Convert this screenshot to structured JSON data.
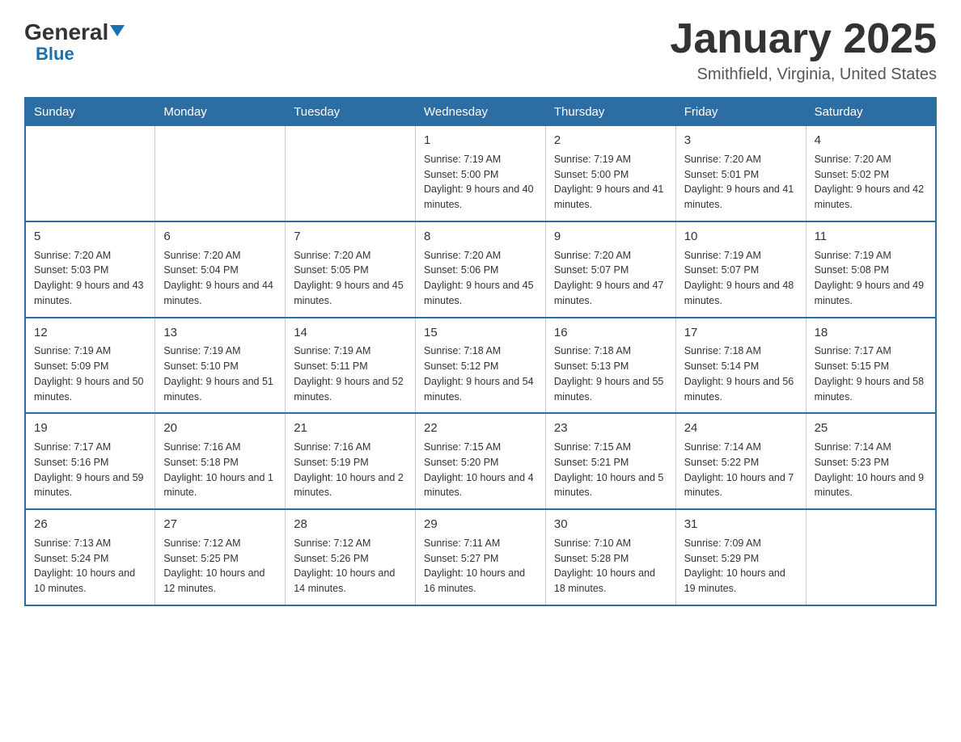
{
  "header": {
    "logo_general": "General",
    "logo_blue": "Blue",
    "month_title": "January 2025",
    "location": "Smithfield, Virginia, United States"
  },
  "days_of_week": [
    "Sunday",
    "Monday",
    "Tuesday",
    "Wednesday",
    "Thursday",
    "Friday",
    "Saturday"
  ],
  "weeks": [
    [
      {
        "day": "",
        "info": ""
      },
      {
        "day": "",
        "info": ""
      },
      {
        "day": "",
        "info": ""
      },
      {
        "day": "1",
        "info": "Sunrise: 7:19 AM\nSunset: 5:00 PM\nDaylight: 9 hours\nand 40 minutes."
      },
      {
        "day": "2",
        "info": "Sunrise: 7:19 AM\nSunset: 5:00 PM\nDaylight: 9 hours\nand 41 minutes."
      },
      {
        "day": "3",
        "info": "Sunrise: 7:20 AM\nSunset: 5:01 PM\nDaylight: 9 hours\nand 41 minutes."
      },
      {
        "day": "4",
        "info": "Sunrise: 7:20 AM\nSunset: 5:02 PM\nDaylight: 9 hours\nand 42 minutes."
      }
    ],
    [
      {
        "day": "5",
        "info": "Sunrise: 7:20 AM\nSunset: 5:03 PM\nDaylight: 9 hours\nand 43 minutes."
      },
      {
        "day": "6",
        "info": "Sunrise: 7:20 AM\nSunset: 5:04 PM\nDaylight: 9 hours\nand 44 minutes."
      },
      {
        "day": "7",
        "info": "Sunrise: 7:20 AM\nSunset: 5:05 PM\nDaylight: 9 hours\nand 45 minutes."
      },
      {
        "day": "8",
        "info": "Sunrise: 7:20 AM\nSunset: 5:06 PM\nDaylight: 9 hours\nand 45 minutes."
      },
      {
        "day": "9",
        "info": "Sunrise: 7:20 AM\nSunset: 5:07 PM\nDaylight: 9 hours\nand 47 minutes."
      },
      {
        "day": "10",
        "info": "Sunrise: 7:19 AM\nSunset: 5:07 PM\nDaylight: 9 hours\nand 48 minutes."
      },
      {
        "day": "11",
        "info": "Sunrise: 7:19 AM\nSunset: 5:08 PM\nDaylight: 9 hours\nand 49 minutes."
      }
    ],
    [
      {
        "day": "12",
        "info": "Sunrise: 7:19 AM\nSunset: 5:09 PM\nDaylight: 9 hours\nand 50 minutes."
      },
      {
        "day": "13",
        "info": "Sunrise: 7:19 AM\nSunset: 5:10 PM\nDaylight: 9 hours\nand 51 minutes."
      },
      {
        "day": "14",
        "info": "Sunrise: 7:19 AM\nSunset: 5:11 PM\nDaylight: 9 hours\nand 52 minutes."
      },
      {
        "day": "15",
        "info": "Sunrise: 7:18 AM\nSunset: 5:12 PM\nDaylight: 9 hours\nand 54 minutes."
      },
      {
        "day": "16",
        "info": "Sunrise: 7:18 AM\nSunset: 5:13 PM\nDaylight: 9 hours\nand 55 minutes."
      },
      {
        "day": "17",
        "info": "Sunrise: 7:18 AM\nSunset: 5:14 PM\nDaylight: 9 hours\nand 56 minutes."
      },
      {
        "day": "18",
        "info": "Sunrise: 7:17 AM\nSunset: 5:15 PM\nDaylight: 9 hours\nand 58 minutes."
      }
    ],
    [
      {
        "day": "19",
        "info": "Sunrise: 7:17 AM\nSunset: 5:16 PM\nDaylight: 9 hours\nand 59 minutes."
      },
      {
        "day": "20",
        "info": "Sunrise: 7:16 AM\nSunset: 5:18 PM\nDaylight: 10 hours\nand 1 minute."
      },
      {
        "day": "21",
        "info": "Sunrise: 7:16 AM\nSunset: 5:19 PM\nDaylight: 10 hours\nand 2 minutes."
      },
      {
        "day": "22",
        "info": "Sunrise: 7:15 AM\nSunset: 5:20 PM\nDaylight: 10 hours\nand 4 minutes."
      },
      {
        "day": "23",
        "info": "Sunrise: 7:15 AM\nSunset: 5:21 PM\nDaylight: 10 hours\nand 5 minutes."
      },
      {
        "day": "24",
        "info": "Sunrise: 7:14 AM\nSunset: 5:22 PM\nDaylight: 10 hours\nand 7 minutes."
      },
      {
        "day": "25",
        "info": "Sunrise: 7:14 AM\nSunset: 5:23 PM\nDaylight: 10 hours\nand 9 minutes."
      }
    ],
    [
      {
        "day": "26",
        "info": "Sunrise: 7:13 AM\nSunset: 5:24 PM\nDaylight: 10 hours\nand 10 minutes."
      },
      {
        "day": "27",
        "info": "Sunrise: 7:12 AM\nSunset: 5:25 PM\nDaylight: 10 hours\nand 12 minutes."
      },
      {
        "day": "28",
        "info": "Sunrise: 7:12 AM\nSunset: 5:26 PM\nDaylight: 10 hours\nand 14 minutes."
      },
      {
        "day": "29",
        "info": "Sunrise: 7:11 AM\nSunset: 5:27 PM\nDaylight: 10 hours\nand 16 minutes."
      },
      {
        "day": "30",
        "info": "Sunrise: 7:10 AM\nSunset: 5:28 PM\nDaylight: 10 hours\nand 18 minutes."
      },
      {
        "day": "31",
        "info": "Sunrise: 7:09 AM\nSunset: 5:29 PM\nDaylight: 10 hours\nand 19 minutes."
      },
      {
        "day": "",
        "info": ""
      }
    ]
  ]
}
